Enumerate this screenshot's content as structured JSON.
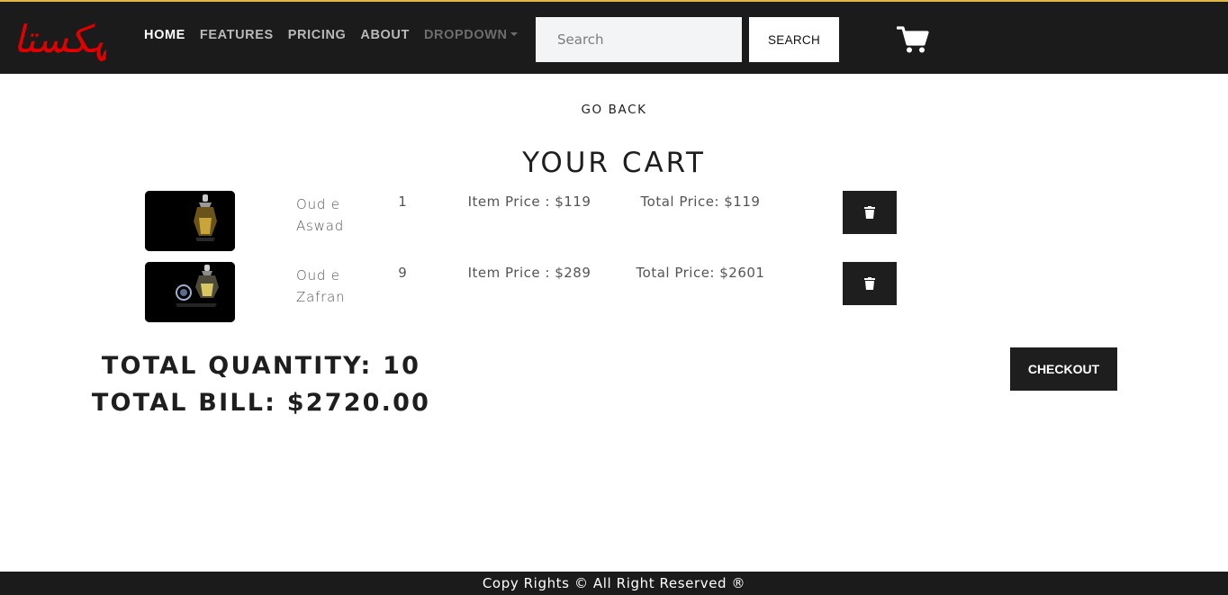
{
  "brand": {
    "logo_text": "مہکستان",
    "logo_color": "#e00000",
    "accent_color": "#e0b54a"
  },
  "nav": {
    "links": [
      {
        "label": "HOME",
        "state": "active"
      },
      {
        "label": "FEATURES",
        "state": "normal"
      },
      {
        "label": "PRICING",
        "state": "normal"
      },
      {
        "label": "ABOUT",
        "state": "normal"
      },
      {
        "label": "DROPDOWN",
        "state": "disabled"
      }
    ],
    "search_placeholder": "Search",
    "search_button": "SEARCH",
    "cart_icon": "shopping-cart-icon"
  },
  "main": {
    "go_back": "GO BACK",
    "title": "YOUR CART",
    "items": [
      {
        "name": "Oud e Aswad",
        "quantity": "1",
        "item_price": "Item Price : $119",
        "total_price": "Total Price: $119",
        "image": "perfume-bottle-gold"
      },
      {
        "name": "Oud e Zafran",
        "quantity": "9",
        "item_price": "Item Price : $289",
        "total_price": "Total Price: $2601",
        "image": "perfume-bottle-crystal"
      }
    ],
    "delete_icon": "trash-icon",
    "total_quantity": "TOTAL QUANTITY: 10",
    "total_bill": "TOTAL BILL: $2720.00",
    "checkout": "CHECKOUT"
  },
  "footer": {
    "text": "Copy Rights © All Right Reserved ®"
  }
}
